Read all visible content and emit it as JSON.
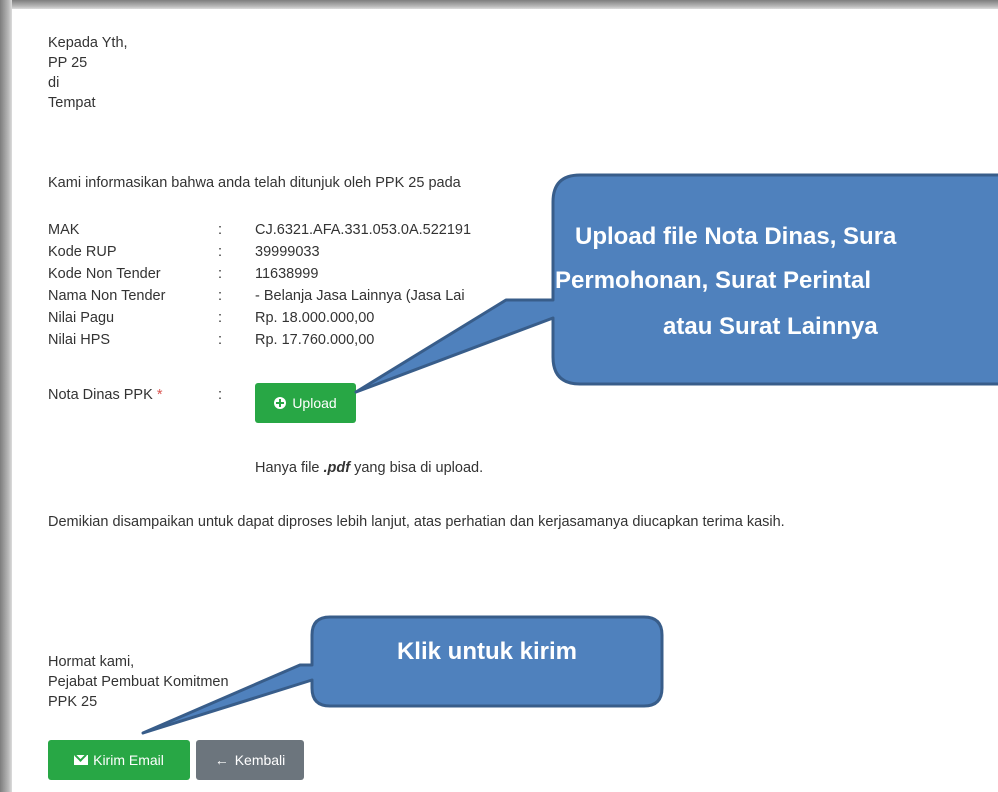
{
  "letter": {
    "greeting": "Kepada Yth,",
    "recipient": "PP 25",
    "di": "di",
    "tempat": "Tempat",
    "intro": "Kami informasikan bahwa anda telah ditunjuk oleh PPK 25 pada",
    "info": [
      {
        "label": "MAK",
        "sep": ":",
        "value": "CJ.6321.AFA.331.053.0A.522191"
      },
      {
        "label": "Kode RUP",
        "sep": ":",
        "value": "39999033"
      },
      {
        "label": "Kode Non Tender",
        "sep": ":",
        "value": "11638999"
      },
      {
        "label": "Nama Non Tender",
        "sep": ":",
        "value": "- Belanja Jasa Lainnya (Jasa Lai"
      },
      {
        "label": "Nilai Pagu",
        "sep": ":",
        "value": "Rp. 18.000.000,00"
      },
      {
        "label": "Nilai HPS",
        "sep": ":",
        "value": "Rp. 17.760.000,00"
      }
    ],
    "nota_label": "Nota Dinas PPK",
    "nota_required": "*",
    "nota_sep": ":",
    "upload_label": "Upload",
    "hint_prefix": "Hanya file ",
    "hint_ext": ".pdf",
    "hint_suffix": " yang bisa di upload.",
    "closing": "Demikian disampaikan untuk dapat diproses lebih lanjut, atas perhatian dan kerjasamanya diucapkan terima kasih.",
    "regards": "Hormat kami,",
    "signer_role": "Pejabat Pembuat Komitmen",
    "signer": "PPK 25"
  },
  "buttons": {
    "kirim_label": "Kirim Email",
    "kembali_label": "Kembali"
  },
  "callouts": {
    "upload": {
      "line1": "Upload file Nota Dinas, Sura",
      "line2": "Permohonan, Surat Perintal",
      "line3": "atau Surat Lainnya"
    },
    "kirim": "Klik untuk kirim"
  },
  "colors": {
    "success": "#28a745",
    "secondary": "#6c757d",
    "callout_fill": "#4f81bd",
    "callout_border": "#385d8a",
    "required": "#d9534f"
  }
}
